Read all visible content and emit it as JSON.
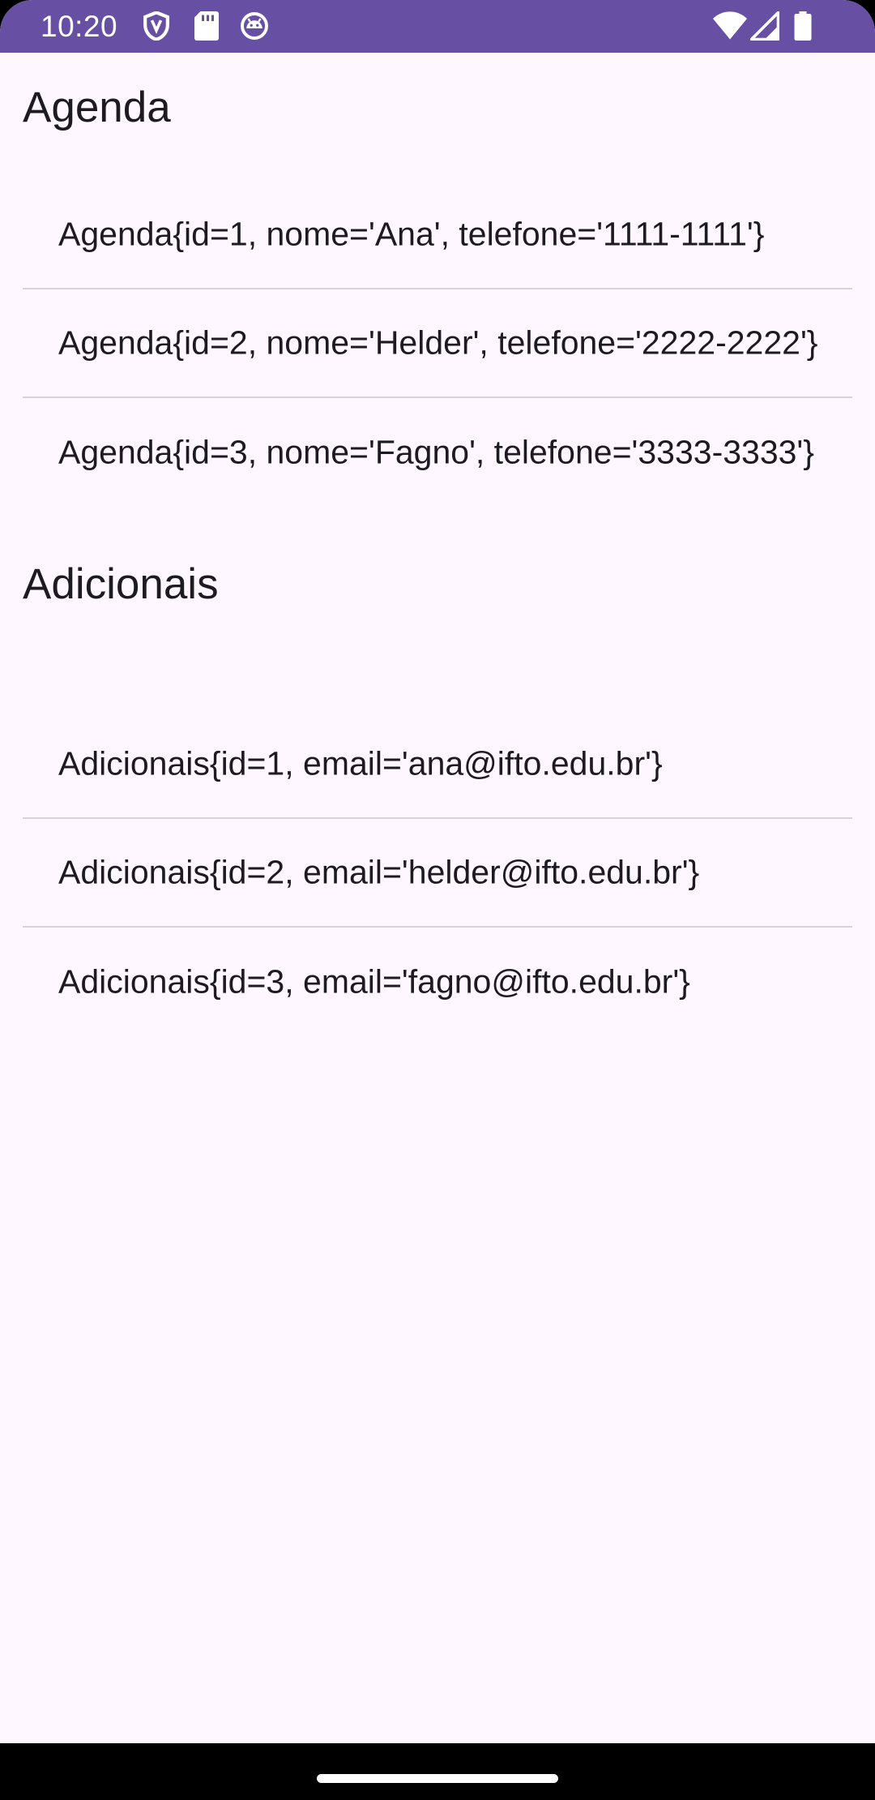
{
  "status_bar": {
    "time": "10:20",
    "background_color": "#6750A4",
    "left_icons": [
      "shield-icon",
      "sd-card-icon",
      "android-face-icon"
    ],
    "right_icons": [
      "wifi-icon",
      "cellular-signal-icon",
      "battery-icon"
    ]
  },
  "agenda": {
    "title": "Agenda",
    "items": [
      {
        "text": "Agenda{id=1, nome='Ana', telefone='1111-1111'}"
      },
      {
        "text": "Agenda{id=2, nome='Helder', telefone='2222-2222'}"
      },
      {
        "text": "Agenda{id=3, nome='Fagno', telefone='3333-3333'}"
      }
    ]
  },
  "adicionais": {
    "title": "Adicionais",
    "items": [
      {
        "text": "Adicionais{id=1, email='ana@ifto.edu.br'}"
      },
      {
        "text": "Adicionais{id=2, email='helder@ifto.edu.br'}"
      },
      {
        "text": "Adicionais{id=3, email='fagno@ifto.edu.br'}"
      }
    ]
  },
  "colors": {
    "background": "#FEF7FF",
    "text": "#1D1B20",
    "divider": "#D6D2D8"
  }
}
